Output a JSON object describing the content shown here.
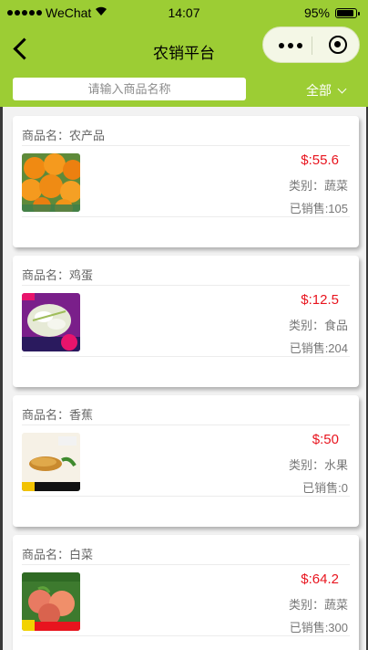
{
  "status": {
    "carrier": "WeChat",
    "time": "14:07",
    "battery": "95%",
    "battery_level": 0.95
  },
  "nav": {
    "title": "农销平台"
  },
  "search": {
    "placeholder": "请输入商品名称"
  },
  "filter": {
    "label": "全部"
  },
  "products": [
    {
      "name": "商品名：农产品",
      "price": "$:55.6",
      "category": "类别：蔬菜",
      "sold": "已销售:105"
    },
    {
      "name": "商品名：鸡蛋",
      "price": "$:12.5",
      "category": "类别：食品",
      "sold": "已销售:204"
    },
    {
      "name": "商品名：香蕉",
      "price": "$:50",
      "category": "类别：水果",
      "sold": "已销售:0"
    },
    {
      "name": "商品名：白菜",
      "price": "$:64.2",
      "category": "类别：蔬菜",
      "sold": "已销售:300"
    }
  ],
  "colors": {
    "header": "#9ccd34",
    "price": "#e8141e"
  }
}
